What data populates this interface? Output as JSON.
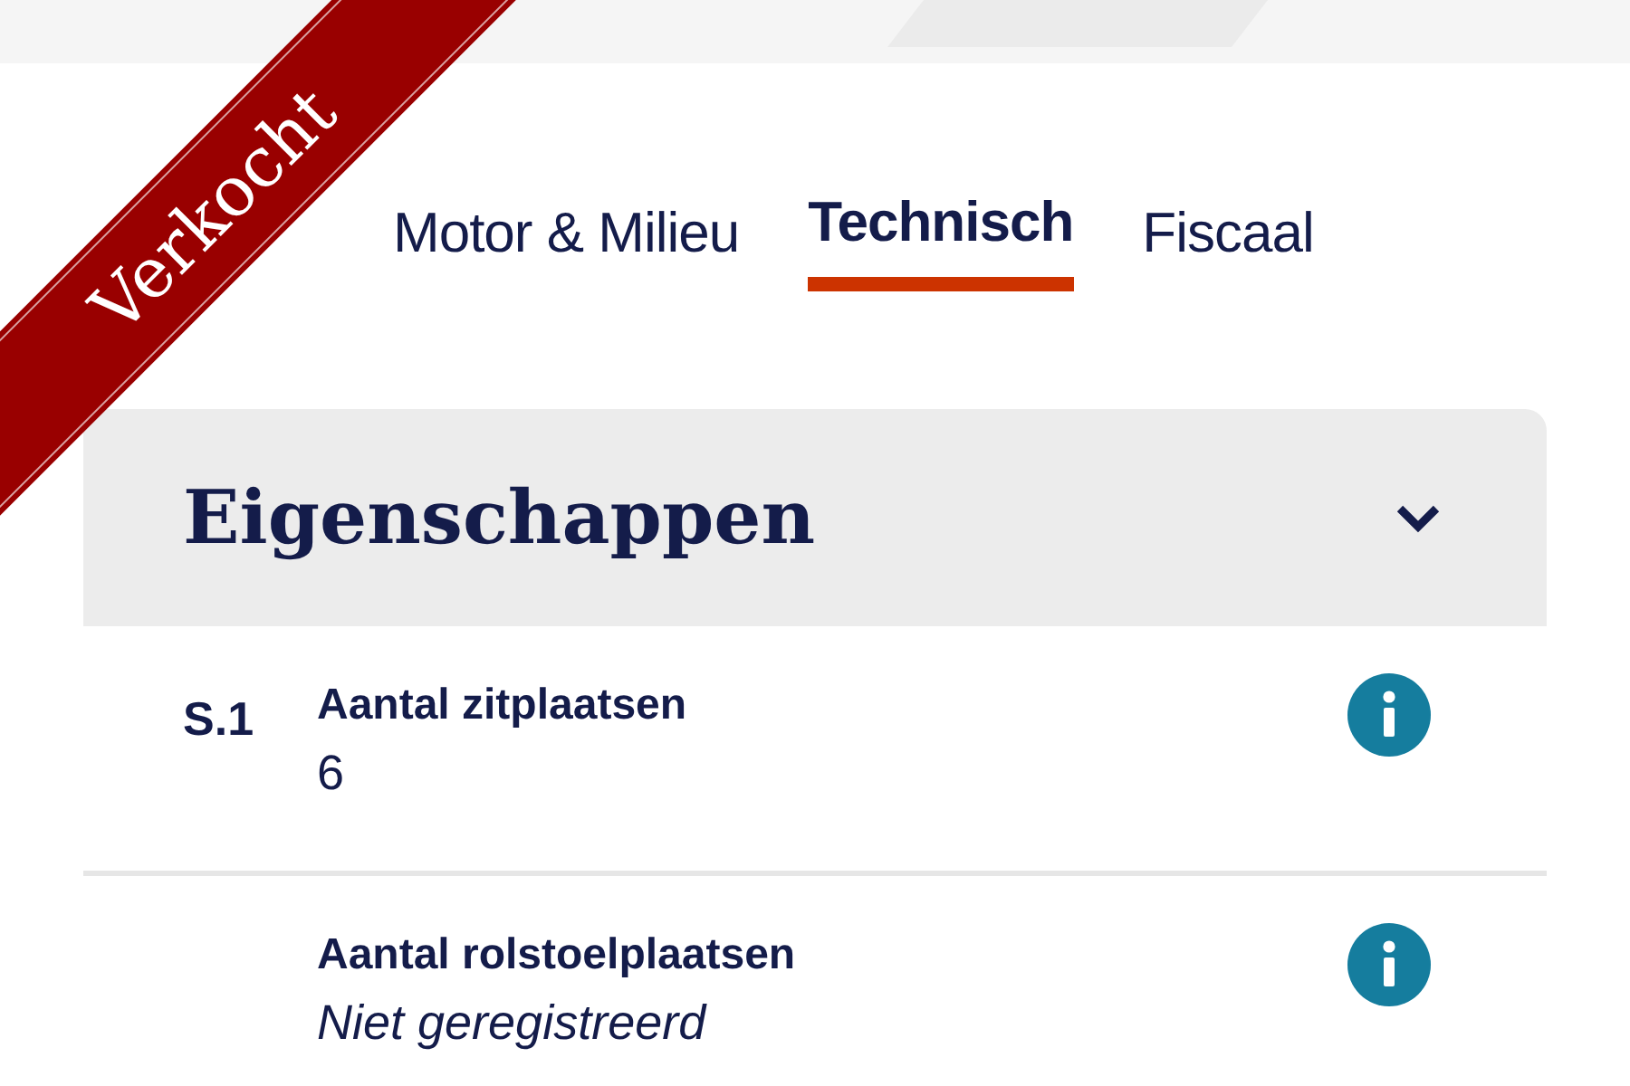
{
  "ribbon": {
    "label": "Verkocht"
  },
  "tabs": [
    {
      "label": "Motor & Milieu",
      "selected": false
    },
    {
      "label": "Technisch",
      "selected": true
    },
    {
      "label": "Fiscaal",
      "selected": false
    }
  ],
  "section": {
    "title": "Eigenschappen",
    "expanded": true,
    "rows": [
      {
        "code": "S.1",
        "label": "Aantal zitplaatsen",
        "value": "6",
        "registered": true
      },
      {
        "label": "Aantal rolstoelplaatsen",
        "value": "Niet geregistreerd",
        "registered": false
      }
    ]
  }
}
